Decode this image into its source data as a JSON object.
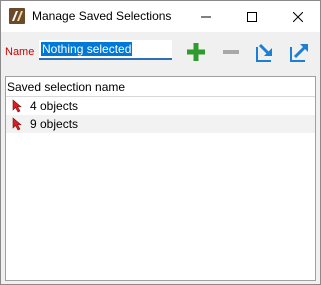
{
  "window": {
    "title": "Manage Saved Selections",
    "buttons": [
      "minimize-icon",
      "maximize-icon",
      "close-icon"
    ]
  },
  "form": {
    "name_label": "Name",
    "name_value": "Nothing selected"
  },
  "toolbar": {
    "icons": [
      "add-icon",
      "remove-icon",
      "import-icon",
      "export-icon"
    ],
    "add_color": "#2e9b2e",
    "remove_color": "#a8a8a8",
    "arrow_color": "#1c7fd6"
  },
  "list": {
    "column_header": "Saved selection name",
    "items": [
      {
        "label": "4 objects",
        "icon": "selection-cursor-icon"
      },
      {
        "label": "9 objects",
        "icon": "selection-cursor-icon"
      }
    ]
  },
  "colors": {
    "label_red": "#cc0000",
    "selection_blue": "#0078d7",
    "cursor_red": "#d42020"
  }
}
